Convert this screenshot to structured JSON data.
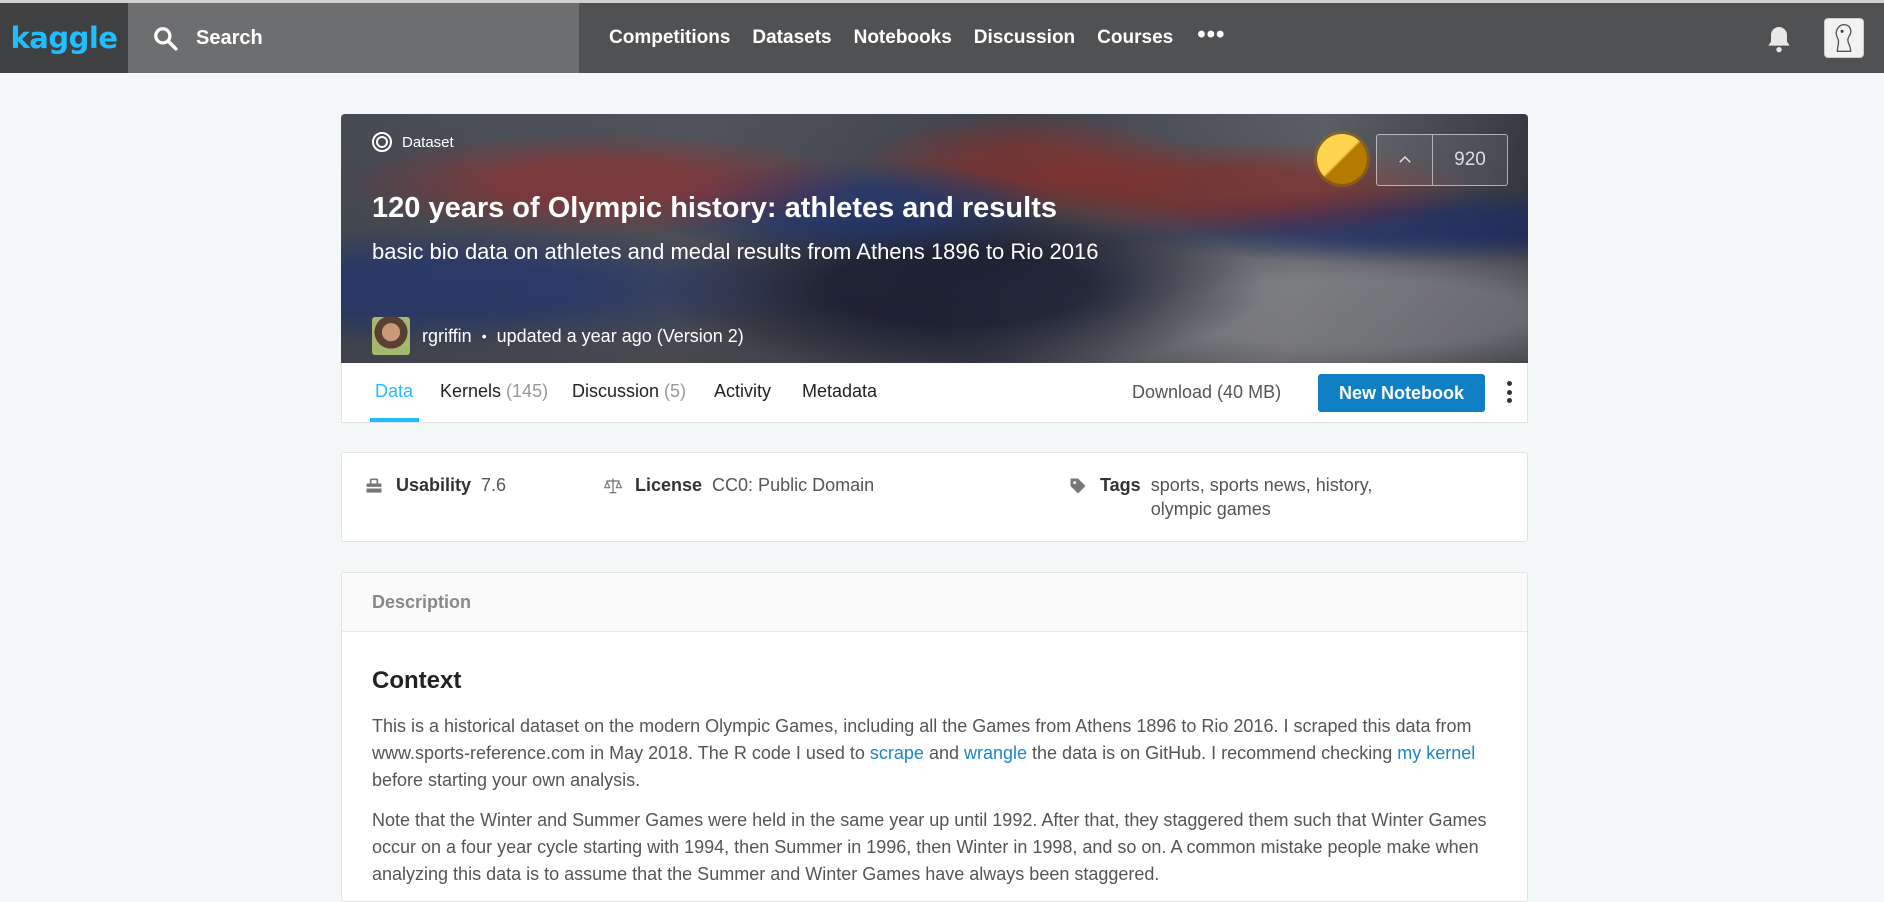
{
  "topbar": {
    "logo": "kaggle",
    "search_placeholder": "Search",
    "nav": [
      "Competitions",
      "Datasets",
      "Notebooks",
      "Discussion",
      "Courses"
    ],
    "more": "•••"
  },
  "hero": {
    "type_label": "Dataset",
    "title": "120 years of Olympic history: athletes and results",
    "subtitle": "basic bio data on athletes and medal results from Athens 1896 to Rio 2016",
    "owner": "rgriffin",
    "separator": "•",
    "updated": "updated a year ago (Version 2)",
    "vote_count": "920",
    "medal_color": "#f4b400"
  },
  "tabs": {
    "items": [
      {
        "label": "Data",
        "count": ""
      },
      {
        "label": "Kernels",
        "count": "(145)"
      },
      {
        "label": "Discussion",
        "count": "(5)"
      },
      {
        "label": "Activity",
        "count": ""
      },
      {
        "label": "Metadata",
        "count": ""
      }
    ],
    "active_color": "#20beff",
    "download": "Download (40 MB)",
    "new_notebook": "New Notebook"
  },
  "meta": {
    "usability_label": "Usability",
    "usability_value": "7.6",
    "license_label": "License",
    "license_value": "CC0: Public Domain",
    "tags_label": "Tags",
    "tags_value": "sports, sports news, history, olympic games"
  },
  "description": {
    "header": "Description",
    "heading": "Context",
    "p1_a": "This is a historical dataset on the modern Olympic Games, including all the Games from Athens 1896 to Rio 2016. I scraped this data from www.sports-reference.com in May 2018. The R code I used to ",
    "p1_link1": "scrape",
    "p1_b": " and ",
    "p1_link2": "wrangle",
    "p1_c": " the data is on GitHub. I recommend checking ",
    "p1_link3": "my kernel",
    "p1_d": " before starting your own analysis.",
    "p2": "Note that the Winter and Summer Games were held in the same year up until 1992. After that, they staggered them such that Winter Games occur on a four year cycle starting with 1994, then Summer in 1996, then Winter in 1998, and so on. A common mistake people make when analyzing this data is to assume that the Summer and Winter Games have always been staggered."
  }
}
